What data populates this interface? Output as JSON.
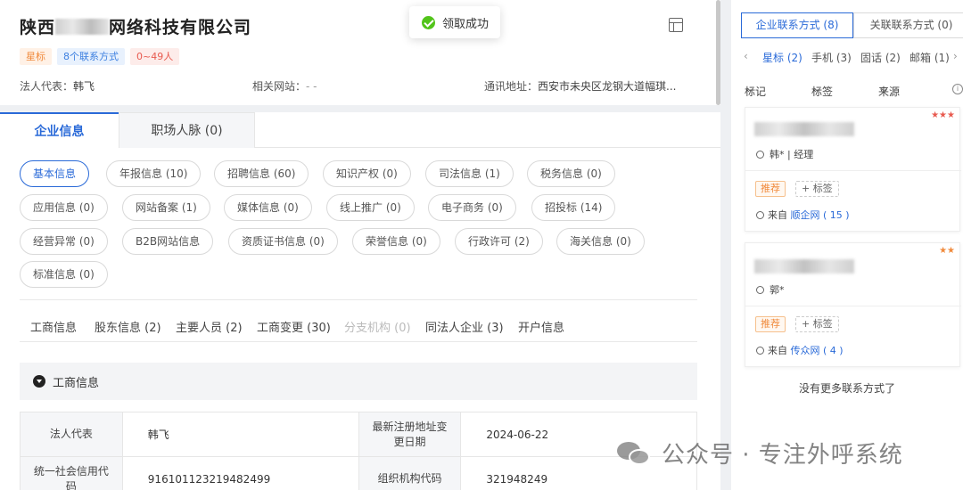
{
  "company": {
    "name_prefix": "陕西",
    "name_suffix": "网络科技有限公司",
    "tags": [
      "星标",
      "8个联系方式",
      "0~49人"
    ],
    "legal_rep_label": "法人代表：",
    "legal_rep": "韩飞",
    "website_label": "相关网站：",
    "website": "- -",
    "address_label": "通讯地址：",
    "address": "西安市未央区龙钢大道幅琪..."
  },
  "toast": {
    "text": "领取成功"
  },
  "tabs": [
    {
      "label": "企业信息"
    },
    {
      "label": "职场人脉 (0)"
    }
  ],
  "chips": [
    "基本信息",
    "年报信息 (10)",
    "招聘信息 (60)",
    "知识产权 (0)",
    "司法信息 (1)",
    "税务信息 (0)",
    "应用信息 (0)",
    "网站备案 (1)",
    "媒体信息 (0)",
    "线上推广 (0)",
    "电子商务 (0)",
    "招投标 (14)",
    "经营异常 (0)",
    "B2B网站信息",
    "资质证书信息 (0)",
    "荣誉信息 (0)",
    "行政许可 (2)",
    "海关信息 (0)",
    "标准信息 (0)"
  ],
  "subnav": [
    "工商信息",
    "股东信息 (2)",
    "主要人员 (2)",
    "工商变更 (30)",
    "分支机构 (0)",
    "同法人企业 (3)",
    "开户信息"
  ],
  "section": {
    "title": "工商信息"
  },
  "table": {
    "rows": [
      {
        "label1": "法人代表",
        "value1": "韩飞",
        "label2": "最新注册地址变更日期",
        "value2": "2024-06-22"
      },
      {
        "label1": "统一社会信用代码",
        "value1": "916101123219482499",
        "label2": "组织机构代码",
        "value2": "321948249"
      }
    ]
  },
  "right": {
    "tabs": [
      "企业联系方式 (8)",
      "关联联系方式 (0)"
    ],
    "filters": [
      "星标 (2)",
      "手机 (3)",
      "固话 (2)",
      "邮箱 (1)"
    ],
    "sorts": [
      "标记",
      "标签",
      "来源"
    ],
    "info_icon": "i",
    "cards": [
      {
        "stars": "★★★",
        "person": "韩* | 经理",
        "recommend": "推荐",
        "add_tag": "+ 标签",
        "source_label": "来自",
        "source": "顺企网 ( 15 )"
      },
      {
        "stars": "★★",
        "person": "郭*",
        "recommend": "推荐",
        "add_tag": "+ 标签",
        "source_label": "来自",
        "source": "传众网 ( 4 )"
      }
    ],
    "no_more": "没有更多联系方式了"
  },
  "watermark": {
    "text": "公众号 · 专注外呼系统"
  },
  "colors": {
    "primary": "#2a6ad8",
    "orange": "#f08a3c",
    "red": "#e85a4f",
    "success": "#52c41a"
  }
}
